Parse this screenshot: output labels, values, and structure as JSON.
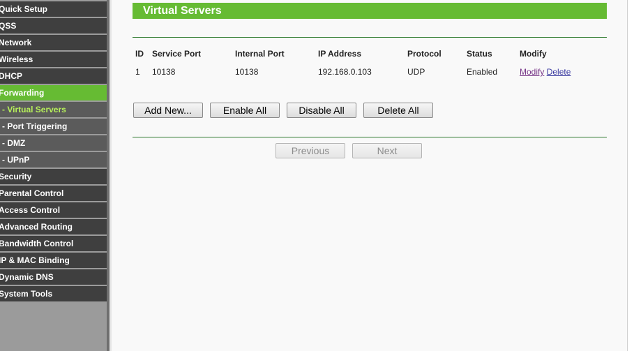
{
  "sidebar": {
    "items": [
      {
        "label": "Quick Setup",
        "kind": "top"
      },
      {
        "label": "QSS",
        "kind": "top"
      },
      {
        "label": "Network",
        "kind": "top"
      },
      {
        "label": "Wireless",
        "kind": "top"
      },
      {
        "label": "DHCP",
        "kind": "top"
      },
      {
        "label": "Forwarding",
        "kind": "top",
        "active": true
      },
      {
        "label": "- Virtual Servers",
        "kind": "sub",
        "current": true
      },
      {
        "label": "- Port Triggering",
        "kind": "sub"
      },
      {
        "label": "- DMZ",
        "kind": "sub"
      },
      {
        "label": "- UPnP",
        "kind": "sub"
      },
      {
        "label": "Security",
        "kind": "top"
      },
      {
        "label": "Parental Control",
        "kind": "top"
      },
      {
        "label": "Access Control",
        "kind": "top"
      },
      {
        "label": "Advanced Routing",
        "kind": "top"
      },
      {
        "label": "Bandwidth Control",
        "kind": "top"
      },
      {
        "label": "IP & MAC Binding",
        "kind": "top"
      },
      {
        "label": "Dynamic DNS",
        "kind": "top"
      },
      {
        "label": "System Tools",
        "kind": "top"
      }
    ]
  },
  "page": {
    "title": "Virtual Servers"
  },
  "table": {
    "headers": {
      "id": "ID",
      "service_port": "Service Port",
      "internal_port": "Internal Port",
      "ip_address": "IP Address",
      "protocol": "Protocol",
      "status": "Status",
      "modify": "Modify"
    },
    "rows": [
      {
        "id": "1",
        "service_port": "10138",
        "internal_port": "10138",
        "ip_address": "192.168.0.103",
        "protocol": "UDP",
        "status": "Enabled",
        "modify_label": "Modify",
        "delete_label": "Delete"
      }
    ]
  },
  "buttons": {
    "add_new": "Add New...",
    "enable_all": "Enable All",
    "disable_all": "Disable All",
    "delete_all": "Delete All",
    "previous": "Previous",
    "next": "Next"
  },
  "colors": {
    "accent_green": "#66bb33",
    "sidebar_item": "#3f3f3f",
    "sidebar_subitem": "#5b5b5b",
    "current_subitem_text": "#b6f05a"
  }
}
